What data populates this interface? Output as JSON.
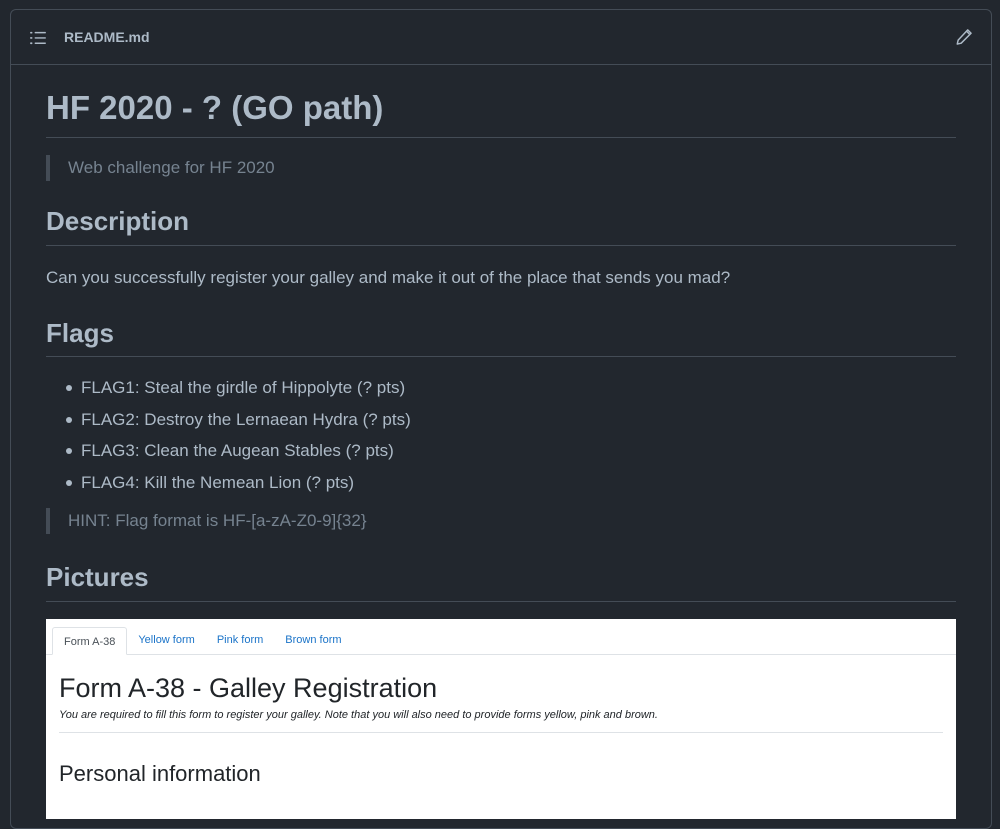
{
  "header": {
    "title": "README.md",
    "list_icon": "list-unordered-icon",
    "edit_icon": "pencil-icon"
  },
  "readme": {
    "title": "HF 2020 - ? (GO path)",
    "tagline": "Web challenge for HF 2020",
    "description_heading": "Description",
    "description_text": "Can you successfully register your galley and make it out of the place that sends you mad?",
    "flags_heading": "Flags",
    "flags": [
      "FLAG1: Steal the girdle of Hippolyte (? pts)",
      "FLAG2: Destroy the Lernaean Hydra (? pts)",
      "FLAG3: Clean the Augean Stables (? pts)",
      "FLAG4: Kill the Nemean Lion (? pts)"
    ],
    "hint": "HINT: Flag format is HF-[a-zA-Z0-9]{32}",
    "pictures_heading": "Pictures"
  },
  "picture": {
    "tabs": [
      "Form A-38",
      "Yellow form",
      "Pink form",
      "Brown form"
    ],
    "active_tab": "Form A-38",
    "form_title": "Form A-38 - Galley Registration",
    "form_subtitle": "You are required to fill this form to register your galley. Note that you will also need to provide forms yellow, pink and brown.",
    "section_heading": "Personal information"
  },
  "colors": {
    "background": "#22272e",
    "border": "#444c56",
    "text": "#adbac7",
    "muted": "#768390",
    "link": "#1a73c8"
  }
}
